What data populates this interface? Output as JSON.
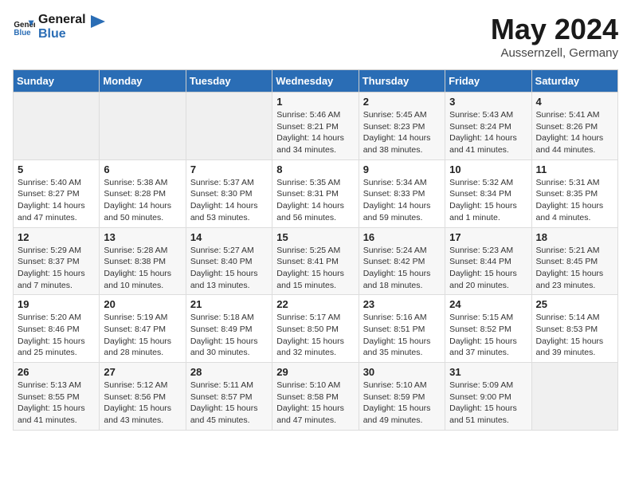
{
  "logo": {
    "text_general": "General",
    "text_blue": "Blue"
  },
  "header": {
    "month_year": "May 2024",
    "location": "Aussernzell, Germany"
  },
  "days_of_week": [
    "Sunday",
    "Monday",
    "Tuesday",
    "Wednesday",
    "Thursday",
    "Friday",
    "Saturday"
  ],
  "weeks": [
    [
      {
        "day": "",
        "empty": true
      },
      {
        "day": "",
        "empty": true
      },
      {
        "day": "",
        "empty": true
      },
      {
        "day": "1",
        "sunrise": "5:46 AM",
        "sunset": "8:21 PM",
        "daylight": "14 hours and 34 minutes."
      },
      {
        "day": "2",
        "sunrise": "5:45 AM",
        "sunset": "8:23 PM",
        "daylight": "14 hours and 38 minutes."
      },
      {
        "day": "3",
        "sunrise": "5:43 AM",
        "sunset": "8:24 PM",
        "daylight": "14 hours and 41 minutes."
      },
      {
        "day": "4",
        "sunrise": "5:41 AM",
        "sunset": "8:26 PM",
        "daylight": "14 hours and 44 minutes."
      }
    ],
    [
      {
        "day": "5",
        "sunrise": "5:40 AM",
        "sunset": "8:27 PM",
        "daylight": "14 hours and 47 minutes."
      },
      {
        "day": "6",
        "sunrise": "5:38 AM",
        "sunset": "8:28 PM",
        "daylight": "14 hours and 50 minutes."
      },
      {
        "day": "7",
        "sunrise": "5:37 AM",
        "sunset": "8:30 PM",
        "daylight": "14 hours and 53 minutes."
      },
      {
        "day": "8",
        "sunrise": "5:35 AM",
        "sunset": "8:31 PM",
        "daylight": "14 hours and 56 minutes."
      },
      {
        "day": "9",
        "sunrise": "5:34 AM",
        "sunset": "8:33 PM",
        "daylight": "14 hours and 59 minutes."
      },
      {
        "day": "10",
        "sunrise": "5:32 AM",
        "sunset": "8:34 PM",
        "daylight": "15 hours and 1 minute."
      },
      {
        "day": "11",
        "sunrise": "5:31 AM",
        "sunset": "8:35 PM",
        "daylight": "15 hours and 4 minutes."
      }
    ],
    [
      {
        "day": "12",
        "sunrise": "5:29 AM",
        "sunset": "8:37 PM",
        "daylight": "15 hours and 7 minutes."
      },
      {
        "day": "13",
        "sunrise": "5:28 AM",
        "sunset": "8:38 PM",
        "daylight": "15 hours and 10 minutes."
      },
      {
        "day": "14",
        "sunrise": "5:27 AM",
        "sunset": "8:40 PM",
        "daylight": "15 hours and 13 minutes."
      },
      {
        "day": "15",
        "sunrise": "5:25 AM",
        "sunset": "8:41 PM",
        "daylight": "15 hours and 15 minutes."
      },
      {
        "day": "16",
        "sunrise": "5:24 AM",
        "sunset": "8:42 PM",
        "daylight": "15 hours and 18 minutes."
      },
      {
        "day": "17",
        "sunrise": "5:23 AM",
        "sunset": "8:44 PM",
        "daylight": "15 hours and 20 minutes."
      },
      {
        "day": "18",
        "sunrise": "5:21 AM",
        "sunset": "8:45 PM",
        "daylight": "15 hours and 23 minutes."
      }
    ],
    [
      {
        "day": "19",
        "sunrise": "5:20 AM",
        "sunset": "8:46 PM",
        "daylight": "15 hours and 25 minutes."
      },
      {
        "day": "20",
        "sunrise": "5:19 AM",
        "sunset": "8:47 PM",
        "daylight": "15 hours and 28 minutes."
      },
      {
        "day": "21",
        "sunrise": "5:18 AM",
        "sunset": "8:49 PM",
        "daylight": "15 hours and 30 minutes."
      },
      {
        "day": "22",
        "sunrise": "5:17 AM",
        "sunset": "8:50 PM",
        "daylight": "15 hours and 32 minutes."
      },
      {
        "day": "23",
        "sunrise": "5:16 AM",
        "sunset": "8:51 PM",
        "daylight": "15 hours and 35 minutes."
      },
      {
        "day": "24",
        "sunrise": "5:15 AM",
        "sunset": "8:52 PM",
        "daylight": "15 hours and 37 minutes."
      },
      {
        "day": "25",
        "sunrise": "5:14 AM",
        "sunset": "8:53 PM",
        "daylight": "15 hours and 39 minutes."
      }
    ],
    [
      {
        "day": "26",
        "sunrise": "5:13 AM",
        "sunset": "8:55 PM",
        "daylight": "15 hours and 41 minutes."
      },
      {
        "day": "27",
        "sunrise": "5:12 AM",
        "sunset": "8:56 PM",
        "daylight": "15 hours and 43 minutes."
      },
      {
        "day": "28",
        "sunrise": "5:11 AM",
        "sunset": "8:57 PM",
        "daylight": "15 hours and 45 minutes."
      },
      {
        "day": "29",
        "sunrise": "5:10 AM",
        "sunset": "8:58 PM",
        "daylight": "15 hours and 47 minutes."
      },
      {
        "day": "30",
        "sunrise": "5:10 AM",
        "sunset": "8:59 PM",
        "daylight": "15 hours and 49 minutes."
      },
      {
        "day": "31",
        "sunrise": "5:09 AM",
        "sunset": "9:00 PM",
        "daylight": "15 hours and 51 minutes."
      },
      {
        "day": "",
        "empty": true
      }
    ]
  ]
}
